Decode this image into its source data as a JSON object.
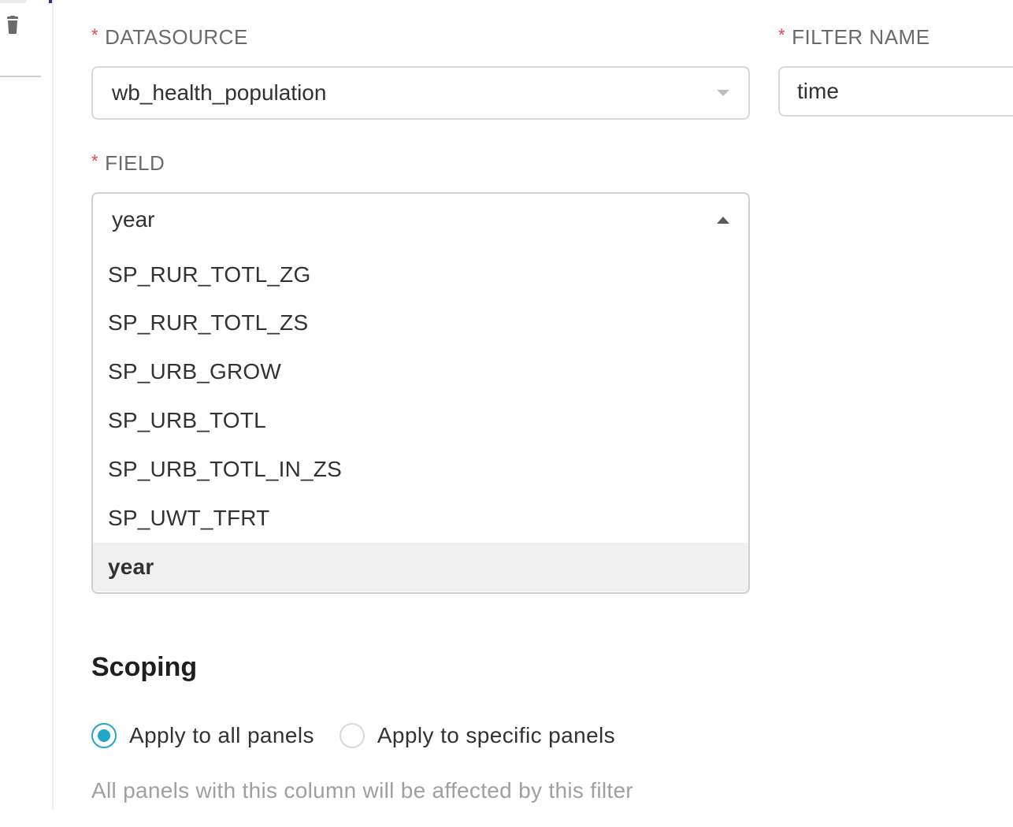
{
  "datasource": {
    "label": "DATASOURCE",
    "required_mark": "*",
    "value": "wb_health_population"
  },
  "filter_name": {
    "label": "FILTER NAME",
    "required_mark": "*",
    "value": "time"
  },
  "field": {
    "label": "FIELD",
    "required_mark": "*",
    "value": "year",
    "options": [
      "SP_RUR_TOTL_ZG",
      "SP_RUR_TOTL_ZS",
      "SP_URB_GROW",
      "SP_URB_TOTL",
      "SP_URB_TOTL_IN_ZS",
      "SP_UWT_TFRT",
      "year"
    ]
  },
  "scoping": {
    "title": "Scoping",
    "options": [
      {
        "label": "Apply to all panels",
        "checked": true
      },
      {
        "label": "Apply to specific panels",
        "checked": false
      }
    ],
    "helper": "All panels with this column will be affected by this filter"
  },
  "colors": {
    "required": "#e04355",
    "radio_active": "#20a7c9",
    "selected_option_bg": "#f0f0f0"
  }
}
